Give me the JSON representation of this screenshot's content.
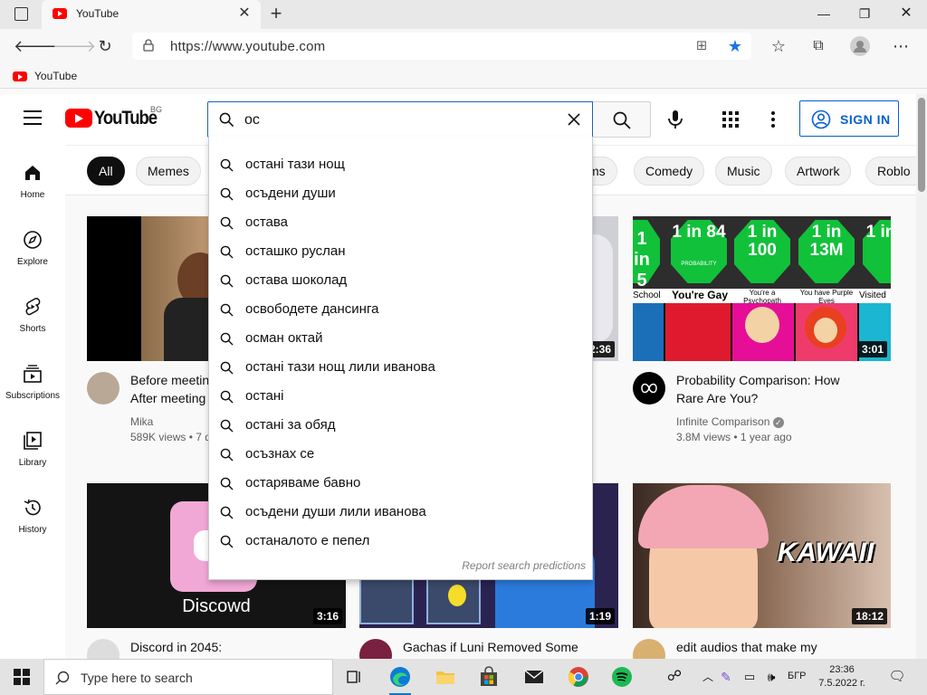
{
  "browser": {
    "tab_title": "YouTube",
    "url": "https://www.youtube.com",
    "favorites": [
      {
        "label": "YouTube"
      }
    ]
  },
  "youtube": {
    "logo_text": "YouTube",
    "region": "BG",
    "search_value": "ос",
    "signin_label": "SIGN IN",
    "chips": [
      "All",
      "Memes",
      "ms",
      "Comedy",
      "Music",
      "Artwork",
      "Roblo"
    ],
    "sidebar": [
      {
        "label": "Home",
        "icon": "home-icon"
      },
      {
        "label": "Explore",
        "icon": "compass-icon"
      },
      {
        "label": "Shorts",
        "icon": "shorts-icon"
      },
      {
        "label": "Subscriptions",
        "icon": "subscriptions-icon"
      },
      {
        "label": "Library",
        "icon": "library-icon"
      },
      {
        "label": "History",
        "icon": "history-icon"
      }
    ],
    "suggestions": [
      "останi тази нощ",
      "осъдени души",
      "остава",
      "осташко руслан",
      "остава шоколад",
      "освободете дансинга",
      "осман октай",
      "останi тази нощ лили иванова",
      "останi",
      "останi за обяд",
      "осъзнах се",
      "остаряваме бавно",
      "осъдени души лили иванова",
      "останалото е пепел"
    ],
    "report_predictions": "Report search predictions",
    "videos": [
      {
        "title": "Before meetin",
        "title2": "After meeting",
        "channel": "Mika",
        "meta": "589K views • 7 d",
        "duration": ""
      },
      {
        "title": "",
        "title2": "",
        "channel": "",
        "meta": "",
        "duration": "2:36"
      },
      {
        "title": "Probability Comparison: How",
        "title2": "Rare Are You?",
        "channel": "Infinite Comparison",
        "meta": "3.8M views • 1 year ago",
        "duration": "3:01",
        "thumb_labels": [
          "1 in 5",
          "1 in 84",
          "1 in 100",
          "1 in 13M",
          "1 in"
        ],
        "thumb_subs": [
          "School",
          "You're Gay",
          "You're a Psychopath",
          "You have Purple Eyes",
          "Visited"
        ]
      },
      {
        "title": "Discord in 2045:",
        "channel": "",
        "meta": "",
        "duration": "3:16",
        "thumb_text": "Discowd"
      },
      {
        "title": "Gachas if Luni Removed Some",
        "channel": "",
        "meta": "",
        "duration": "1:19"
      },
      {
        "title": "edit audios that make my",
        "channel": "",
        "meta": "",
        "duration": "18:12",
        "thumb_text": "KAWAII"
      }
    ],
    "prob_sublabel": "PROBABILITY"
  },
  "taskbar": {
    "search_placeholder": "Type here to search",
    "lang": "БГР",
    "time": "23:36",
    "date": "7.5.2022 г."
  },
  "colors": {
    "youtube_red": "#ff0000",
    "link_blue": "#065fd4",
    "search_focus": "#1c62b9"
  }
}
